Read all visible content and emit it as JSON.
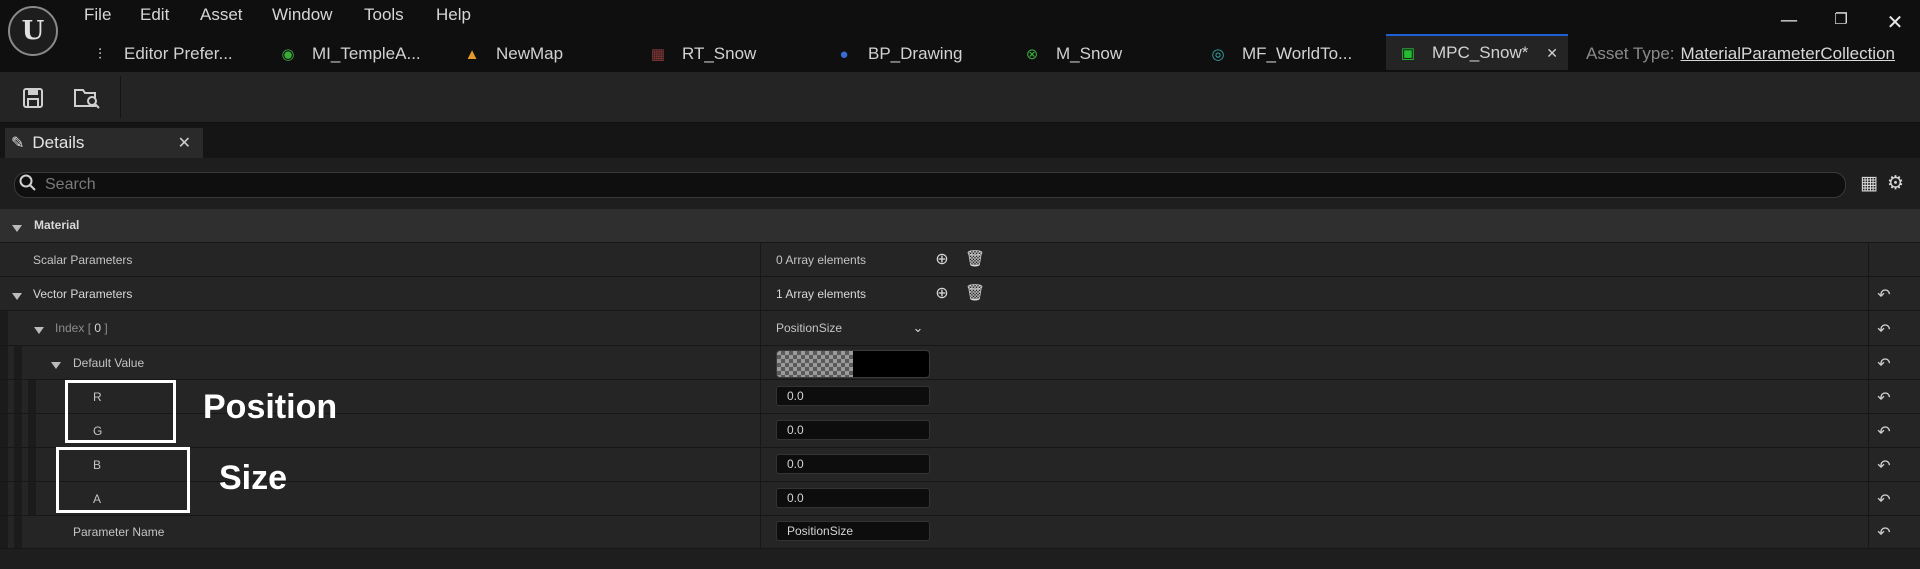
{
  "menu": [
    "File",
    "Edit",
    "Asset",
    "Window",
    "Tools",
    "Help"
  ],
  "tabs": [
    {
      "label": "Editor Prefer...",
      "icon": "sliders-icon"
    },
    {
      "label": "MI_TempleA...",
      "icon": "material-instance-icon"
    },
    {
      "label": "NewMap",
      "icon": "level-map-icon"
    },
    {
      "label": "RT_Snow",
      "icon": "render-target-icon"
    },
    {
      "label": "BP_Drawing",
      "icon": "blueprint-icon"
    },
    {
      "label": "M_Snow",
      "icon": "material-icon"
    },
    {
      "label": "MF_WorldTo...",
      "icon": "material-function-icon"
    },
    {
      "label": "MPC_Snow*",
      "icon": "parameter-collection-icon",
      "active": true
    }
  ],
  "asset_type": {
    "prefix": "Asset Type:",
    "value": "MaterialParameterCollection"
  },
  "details": {
    "tab_label": "Details"
  },
  "search": {
    "placeholder": "Search"
  },
  "material_section": {
    "label": "Material"
  },
  "scalar": {
    "label": "Scalar Parameters",
    "value": "0 Array elements"
  },
  "vector": {
    "label": "Vector Parameters",
    "value": "1 Array elements"
  },
  "index": {
    "prefix": "Index [",
    "num": "0",
    "suffix": "]",
    "value": "PositionSize"
  },
  "default_value": {
    "label": "Default Value"
  },
  "channels": [
    {
      "label": "R",
      "value": "0.0"
    },
    {
      "label": "G",
      "value": "0.0"
    },
    {
      "label": "B",
      "value": "0.0"
    },
    {
      "label": "A",
      "value": "0.0"
    }
  ],
  "param_name": {
    "label": "Parameter Name",
    "value": "PositionSize"
  },
  "annotations": {
    "position": "Position",
    "size": "Size"
  },
  "colors": {
    "accent": "#1f5fd6",
    "highlight_box": "#ffffff",
    "annotation_text": "#ffffff"
  }
}
